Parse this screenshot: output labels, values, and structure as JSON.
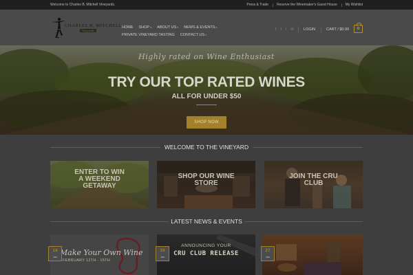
{
  "topbar": {
    "welcome": "Welcome to Charles B. Mitchell Vineyards.",
    "links": [
      "Press & Trade",
      "Reserve the Winemaker's Guest House",
      "My Wishlist"
    ]
  },
  "header": {
    "logo_name": "CHARLES B. MITCHELL",
    "logo_sub": "Vineyards",
    "nav_row1": [
      {
        "label": "HOME",
        "caret": ""
      },
      {
        "label": "SHOP",
        "caret": "▾"
      },
      {
        "label": "ABOUT US",
        "caret": "▾"
      },
      {
        "label": "NEWS & EVENTS",
        "caret": "▾"
      }
    ],
    "nav_row2": [
      {
        "label": "PRIVATE VINEYARD TASTING",
        "caret": ""
      },
      {
        "label": "CONTACT US",
        "caret": "▾"
      }
    ],
    "social_icons": [
      "f",
      "t",
      "i",
      "✉"
    ],
    "login": "LOGIN",
    "cart_label": "CART / $0.00",
    "cart_count": "0"
  },
  "hero": {
    "script": "Highly rated on Wine Enthusiast",
    "headline": "TRY OUR TOP RATED WINES",
    "subheadline": "ALL FOR UNDER $50",
    "button": "SHOP NOW"
  },
  "welcome_section": {
    "title": "WELCOME TO THE VINEYARD"
  },
  "tiles": [
    {
      "label_line1": "ENTER TO WIN",
      "label_line2": "A WEEKEND",
      "label_line3": "GETAWAY"
    },
    {
      "label_line1": "SHOP OUR WINE",
      "label_line2": "STORE",
      "label_line3": ""
    },
    {
      "label_line1": "JOIN THE CRU",
      "label_line2": "CLUB",
      "label_line3": ""
    }
  ],
  "news_section": {
    "title": "LATEST NEWS & EVENTS"
  },
  "news": [
    {
      "day": "14",
      "month": "Jan",
      "image_text1": "Make Your Own Wine",
      "image_text2": "FEBRUARY 12TH - 15TH"
    },
    {
      "day": "19",
      "month": "Jan",
      "image_text1": "ANNOUNCING YOUR",
      "image_text2": "CRU CLUB RELEASE"
    },
    {
      "day": "27",
      "month": "Jan",
      "image_text1": "",
      "image_text2": ""
    }
  ],
  "colors": {
    "accent": "#a3812a",
    "topbar_bg": "#1f1f1f",
    "header_bg": "#4a4a4a",
    "page_bg": "#3e3e3e"
  }
}
